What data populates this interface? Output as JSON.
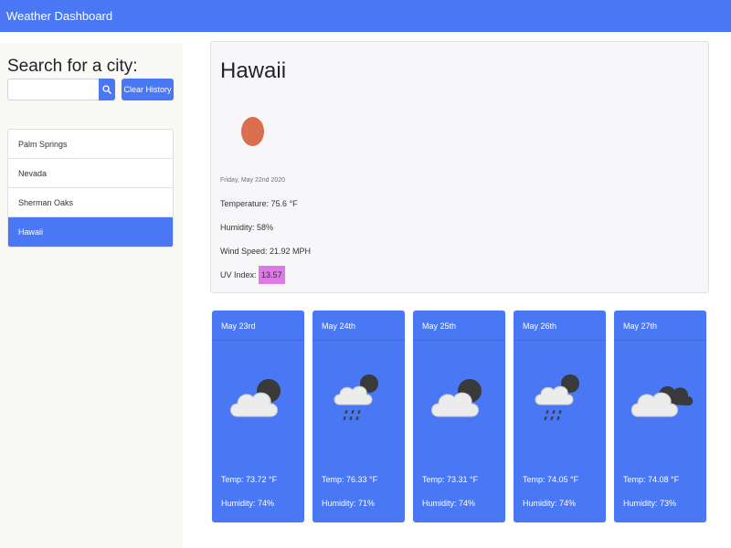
{
  "navbar": {
    "title": "Weather Dashboard"
  },
  "sidebar": {
    "heading": "Search for a city:",
    "search_placeholder": "",
    "search_icon": "search-icon",
    "clear_label": "Clear History",
    "history": [
      {
        "label": "Palm Springs",
        "active": false
      },
      {
        "label": "Nevada",
        "active": false
      },
      {
        "label": "Sherman Oaks",
        "active": false
      },
      {
        "label": "Hawaii",
        "active": true
      }
    ]
  },
  "current": {
    "city": "Hawaii",
    "icon": "clear-sky-icon",
    "date": "Friday, May 22nd 2020",
    "temperature": "Temperature: 75.6 °F",
    "humidity": "Humidity: 58%",
    "wind": "Wind Speed: 21.92 MPH",
    "uv_label": "UV Index:",
    "uv_value": "13.57",
    "uv_color": "#de7ae6"
  },
  "forecast": [
    {
      "date": "May 23rd",
      "icon": "cloud-night-icon",
      "temp": "Temp: 73.72 °F",
      "humidity": "Humidity: 74%"
    },
    {
      "date": "May 24th",
      "icon": "cloud-rain-night-icon",
      "temp": "Temp: 76.33 °F",
      "humidity": "Humidity: 71%"
    },
    {
      "date": "May 25th",
      "icon": "cloud-night-icon",
      "temp": "Temp: 73.31 °F",
      "humidity": "Humidity: 74%"
    },
    {
      "date": "May 26th",
      "icon": "cloud-rain-night-icon",
      "temp": "Temp: 74.05 °F",
      "humidity": "Humidity: 74%"
    },
    {
      "date": "May 27th",
      "icon": "cloud-broken-icon",
      "temp": "Temp: 74.08 °F",
      "humidity": "Humidity: 73%"
    }
  ],
  "colors": {
    "accent": "#4a78f5",
    "sun": "#d96f4f",
    "sidebar_bg": "#f9faf5"
  }
}
